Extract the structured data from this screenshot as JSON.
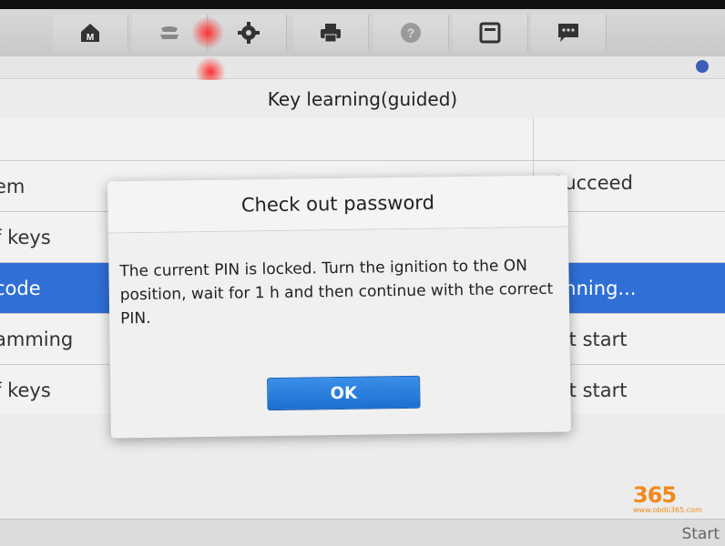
{
  "toolbar": {
    "icons": [
      "home-icon",
      "vehicle-icon",
      "settings-icon",
      "print-icon",
      "help-icon",
      "save-icon",
      "message-icon"
    ],
    "home_letter": "M"
  },
  "page": {
    "title": "Key learning(guided)"
  },
  "table": {
    "rows": [
      {
        "label": "",
        "status": ""
      },
      {
        "label": "em",
        "status": "Succeed"
      },
      {
        "label": "f keys",
        "status": ""
      },
      {
        "label": "code",
        "status": "unning...",
        "selected": true
      },
      {
        "label": "amming",
        "status": "lot start"
      },
      {
        "label": "f keys",
        "status": "lot start"
      }
    ]
  },
  "dialog": {
    "title": "Check out password",
    "message": "The current PIN is locked. Turn the ignition to the ON position, wait for 1 h and then continue with the correct PIN.",
    "ok_label": "OK"
  },
  "bottom": {
    "start_label": "Start"
  },
  "watermark": {
    "number": "365",
    "url": "www.obdii365.com"
  },
  "colors": {
    "selected_row": "#2f6fd6",
    "ok_button": "#2a80e0",
    "watermark": "#f08a1c"
  }
}
